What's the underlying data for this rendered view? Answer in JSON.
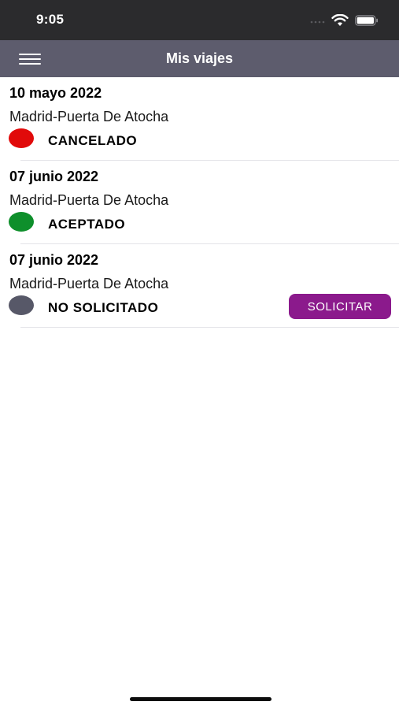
{
  "status_bar": {
    "time": "9:05"
  },
  "header": {
    "title": "Mis viajes"
  },
  "trips": [
    {
      "date": "10 mayo 2022",
      "route": "Madrid-Puerta De Atocha",
      "status": "CANCELADO",
      "status_color": "#e10a0a"
    },
    {
      "date": "07 junio 2022",
      "route": "Madrid-Puerta De Atocha",
      "status": "ACEPTADO",
      "status_color": "#0e8f2b"
    },
    {
      "date": "07 junio 2022",
      "route": "Madrid-Puerta De Atocha",
      "status": "NO SOLICITADO",
      "status_color": "#575868"
    }
  ],
  "request_button": {
    "label": "SOLICITAR",
    "color": "#8b1a8c"
  },
  "icons": {
    "menu": "hamburger-menu-icon",
    "wifi": "wifi-icon",
    "battery": "battery-icon",
    "signal": "cellular-signal-icon"
  }
}
